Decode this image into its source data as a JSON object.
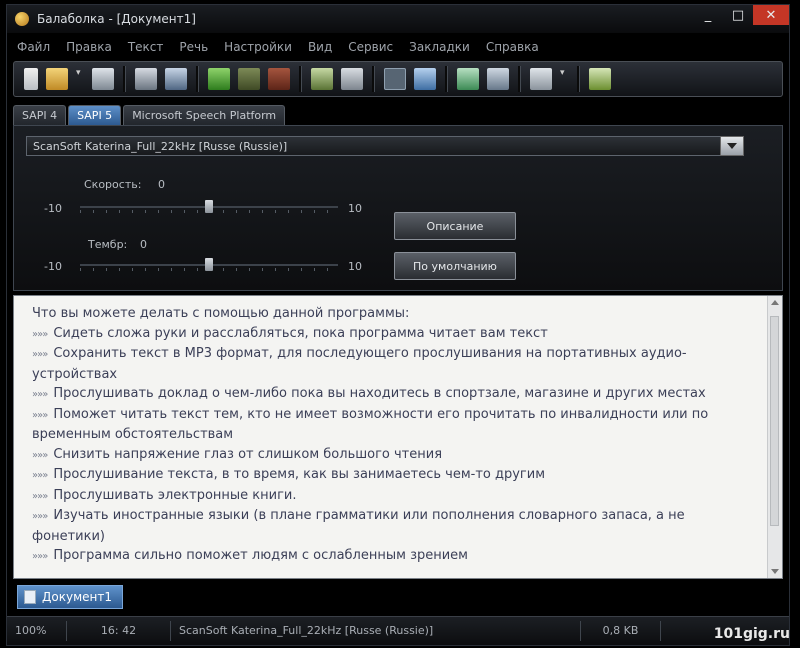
{
  "window": {
    "title": "Балаболка - [Документ1]",
    "controls": {
      "minimize": "_",
      "maximize": "□",
      "close": "✕"
    }
  },
  "menu": [
    "Файл",
    "Правка",
    "Текст",
    "Речь",
    "Настройки",
    "Вид",
    "Сервис",
    "Закладки",
    "Справка"
  ],
  "engine_tabs": [
    "SAPI 4",
    "SAPI 5",
    "Microsoft Speech Platform"
  ],
  "voice_panel": {
    "voice": "ScanSoft Katerina_Full_22kHz [Russe (Russie)]",
    "rate": {
      "label": "Скорость:",
      "value": 0,
      "min_label": "-10",
      "max_label": "10",
      "min": -10,
      "max": 10
    },
    "pitch": {
      "label": "Тембр:",
      "value": 0,
      "min_label": "-10",
      "max_label": "10",
      "min": -10,
      "max": 10
    },
    "about_button": "Описание",
    "default_button": "По умолчанию"
  },
  "editor": {
    "heading": "Что вы можете делать с помощью данной программы:",
    "bullet": "»»»",
    "lines": [
      "Сидеть сложа руки и расслабляться, пока программа читает вам текст",
      "Сохранить текст в MP3 формат, для последующего прослушивания на портативных аудио-устройствах",
      "Прослушивать доклад о чем-либо пока вы находитесь в спортзале, магазине и других местах",
      "Поможет читать текст тем, кто не имеет возможности его прочитать по инвалидности или по временным обстоятельствам",
      "Снизить напряжение глаз от слишком большого чтения",
      "Прослушивание текста, в то время, как вы занимаетесь чем-то другим",
      "Прослушивать электронные книги.",
      "Изучать иностранные языки (в плане грамматики или пополнения словарного запаса, а не фонетики)",
      "Программа сильно поможет людям с ослабленным зрением"
    ]
  },
  "document_tab": "Документ1",
  "status_bar": {
    "zoom": "100%",
    "position": "16: 42",
    "voice": "ScanSoft Katerina_Full_22kHz [Russe (Russie)]",
    "size": "0,8 KB"
  },
  "watermark": "101gig.ru",
  "colors": {
    "accent": "#3d6fa8",
    "close": "#c43626",
    "editor_text": "#3b3f57"
  },
  "toolbar_icons": [
    "new-file-icon",
    "open-folder-icon",
    "dropdown-icon",
    "save-icon",
    "translate-icon",
    "convert-icon",
    "play-icon",
    "pause-icon",
    "stop-icon",
    "split-icon",
    "spell-icon",
    "view-text-icon",
    "book-icon",
    "clipboard-icon",
    "export-icon",
    "dropdown-icon",
    "help-icon"
  ]
}
